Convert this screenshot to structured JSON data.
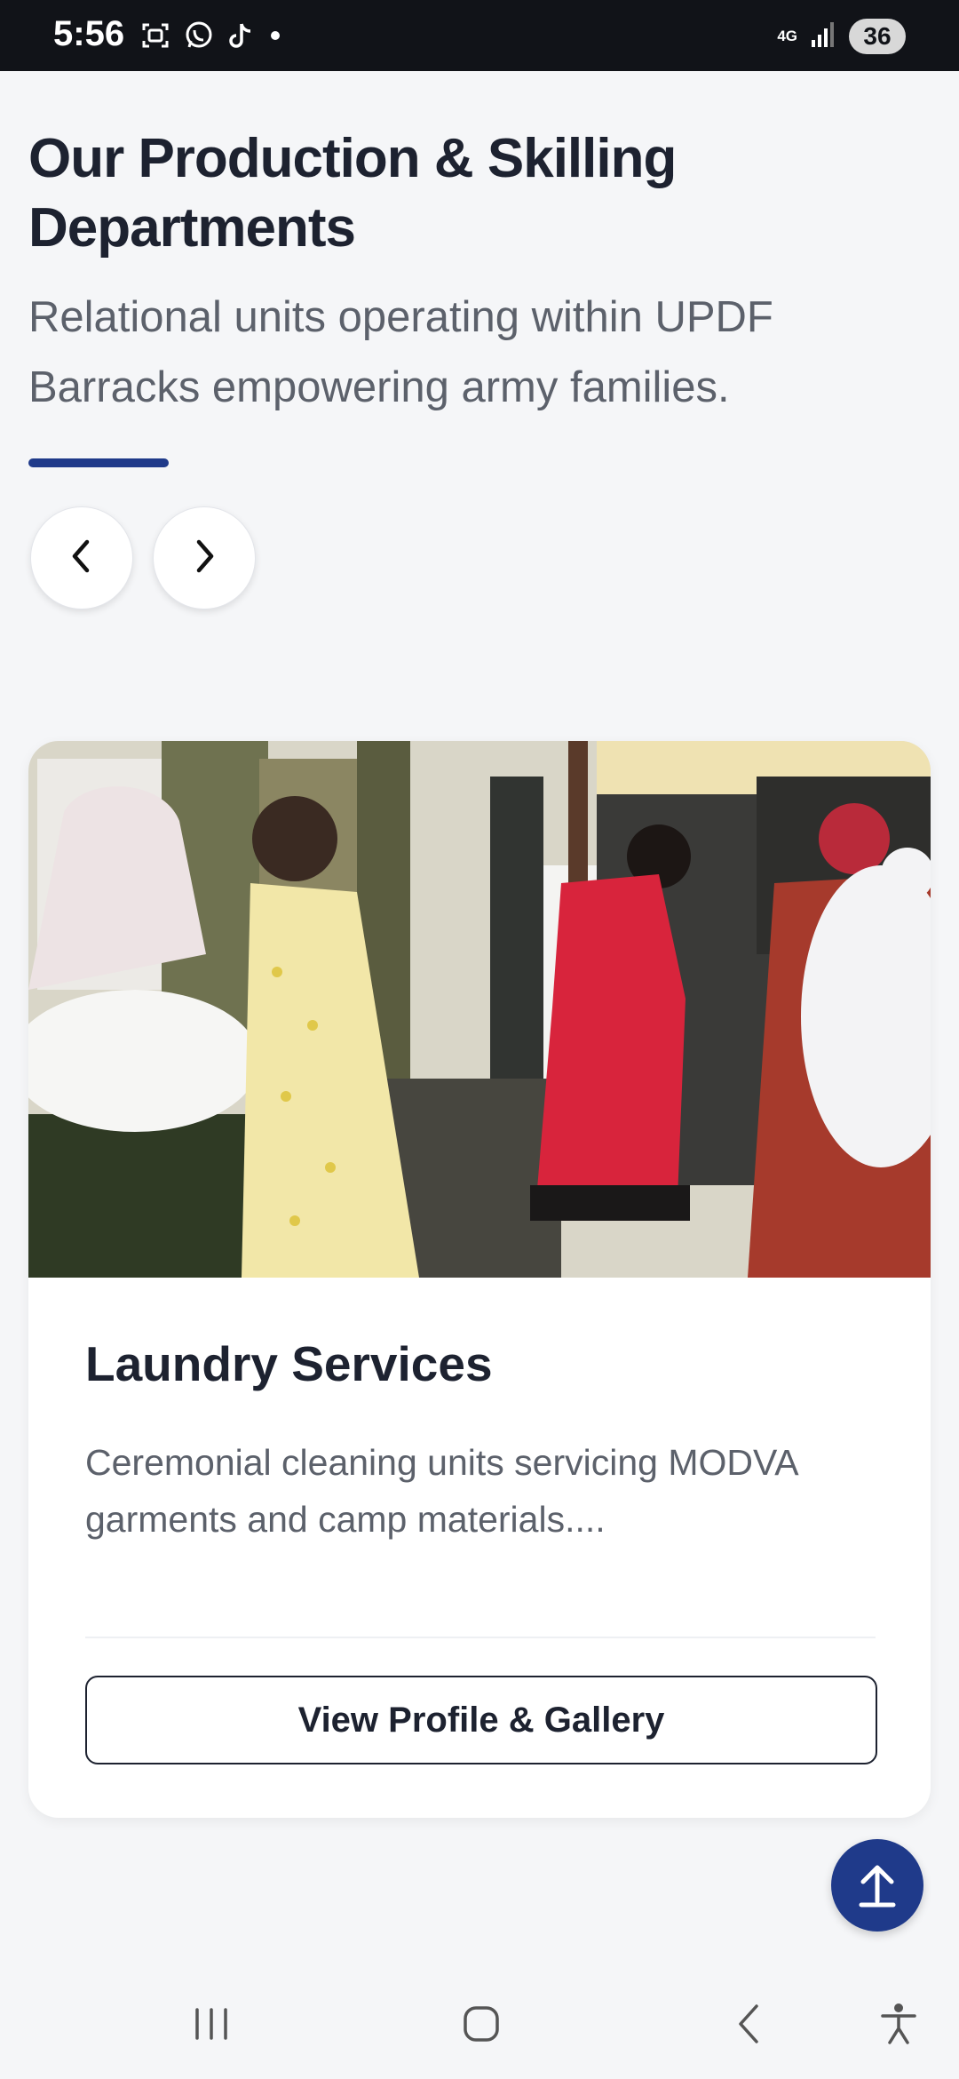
{
  "status_bar": {
    "time": "5:56",
    "network": "4G",
    "battery": "36",
    "icons": [
      "screenshot-icon",
      "whatsapp-icon",
      "tiktok-icon",
      "dot-icon",
      "network-4g-icon",
      "signal-icon",
      "battery-icon"
    ]
  },
  "section": {
    "title": "Our Production & Skilling Departments",
    "subtitle": "Relational units operating within UPDF Barracks empowering army families.",
    "accent_color": "#1f3a8a",
    "prev_icon": "chevron-left-icon",
    "next_icon": "chevron-right-icon"
  },
  "card": {
    "image_icon": "laundry-photo",
    "title": "Laundry Services",
    "description": "Ceremonial cleaning units servicing MODVA garments and camp materials....",
    "button_label": "View Profile & Gallery"
  },
  "fab": {
    "icon": "arrow-up-icon",
    "color": "#1f3a8a"
  },
  "nav_bar": {
    "icons": [
      "recent-apps-icon",
      "home-icon",
      "back-icon",
      "accessibility-icon"
    ]
  }
}
